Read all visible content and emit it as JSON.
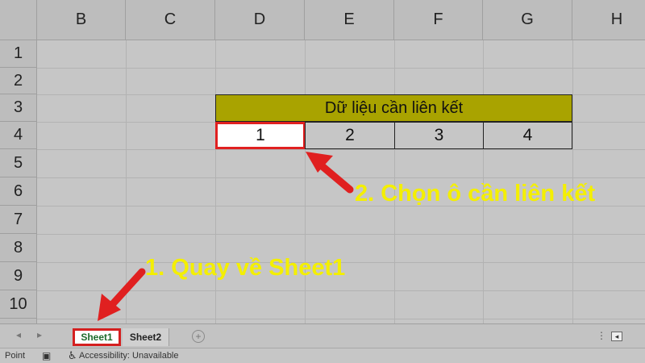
{
  "columns": [
    "B",
    "C",
    "D",
    "E",
    "F",
    "G",
    "H"
  ],
  "rows": [
    "1",
    "2",
    "3",
    "4",
    "5",
    "6",
    "7",
    "8",
    "9",
    "10"
  ],
  "table": {
    "header": "Dữ liệu cần liên kết",
    "values": [
      "1",
      "2",
      "3",
      "4"
    ]
  },
  "annotations": {
    "step1": "1. Quay về Sheet1",
    "step2": "2. Chọn ô cần liên kết"
  },
  "sheet_tabs": [
    {
      "label": "Sheet1",
      "active": true
    },
    {
      "label": "Sheet2",
      "active": false
    }
  ],
  "status_bar": {
    "mode": "Point",
    "accessibility": "Accessibility: Unavailable"
  },
  "colors": {
    "header_fill": "#a9a300",
    "annotation": "#f4ef00",
    "highlight": "#e02020"
  }
}
